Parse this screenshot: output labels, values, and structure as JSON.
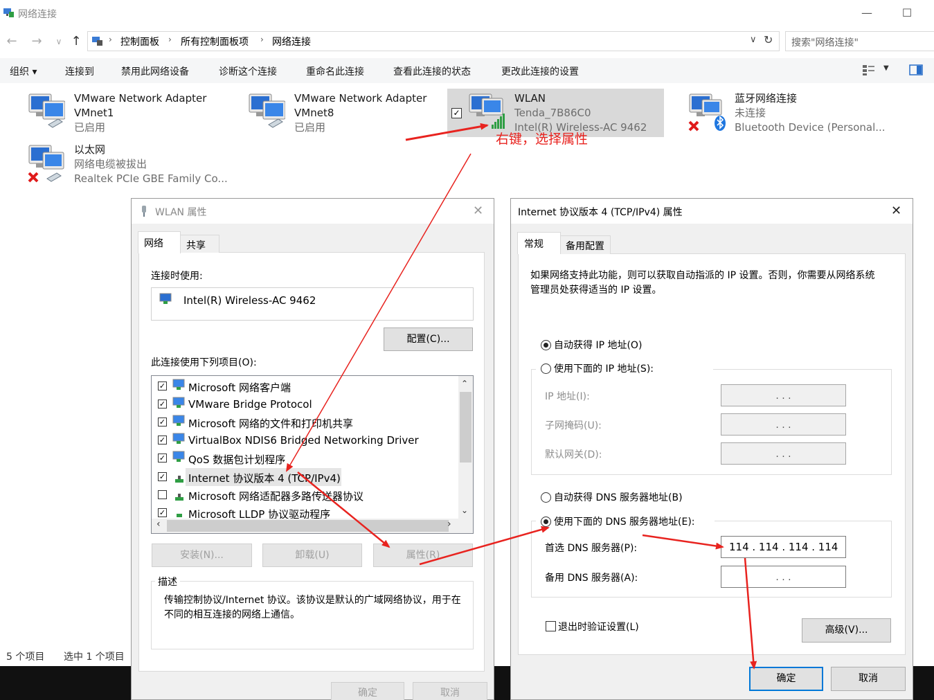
{
  "window": {
    "title": "网络连接",
    "breadcrumb": [
      "控制面板",
      "所有控制面板项",
      "网络连接"
    ],
    "search_placeholder": "搜索\"网络连接\""
  },
  "toolbar": {
    "organize": "组织 ▾",
    "items": [
      "连接到",
      "禁用此网络设备",
      "诊断这个连接",
      "重命名此连接",
      "查看此连接的状态",
      "更改此连接的设置"
    ]
  },
  "connections": [
    {
      "name": "VMware Network Adapter VMnet1",
      "line1": "VMware Network Adapter",
      "line2": "VMnet1",
      "status": "已启用"
    },
    {
      "name": "VMware Network Adapter VMnet8",
      "line1": "VMware Network Adapter",
      "line2": "VMnet8",
      "status": "已启用"
    },
    {
      "name": "WLAN",
      "line1": "WLAN",
      "line2": "Tenda_7B86C0",
      "status": "Intel(R) Wireless-AC 9462"
    },
    {
      "name": "蓝牙网络连接",
      "line1": "蓝牙网络连接",
      "line2": "未连接",
      "status": "Bluetooth Device (Personal..."
    },
    {
      "name": "以太网",
      "line1": "以太网",
      "line2": "网络电缆被拔出",
      "status": "Realtek PCIe GBE Family Co..."
    }
  ],
  "annotation": "右键，选择属性",
  "statusbar": {
    "count": "5 个项目",
    "selected": "选中 1 个项目"
  },
  "wlan_dialog": {
    "title": "WLAN 属性",
    "tabs": [
      "网络",
      "共享"
    ],
    "connect_using_label": "连接时使用:",
    "adapter": "Intel(R) Wireless-AC 9462",
    "configure_button": "配置(C)...",
    "items_label": "此连接使用下列项目(O):",
    "items": [
      {
        "label": "Microsoft 网络客户端",
        "checked": true
      },
      {
        "label": "VMware Bridge Protocol",
        "checked": true
      },
      {
        "label": "Microsoft 网络的文件和打印机共享",
        "checked": true
      },
      {
        "label": "VirtualBox NDIS6 Bridged Networking Driver",
        "checked": true
      },
      {
        "label": "QoS 数据包计划程序",
        "checked": true
      },
      {
        "label": "Internet 协议版本 4 (TCP/IPv4)",
        "checked": true
      },
      {
        "label": "Microsoft 网络适配器多路传送器协议",
        "checked": false
      },
      {
        "label": "Microsoft LLDP 协议驱动程序",
        "checked": true
      }
    ],
    "install_button": "安装(N)...",
    "uninstall_button": "卸载(U)",
    "properties_button": "属性(R)",
    "description_label": "描述",
    "description": "传输控制协议/Internet 协议。该协议是默认的广域网络协议，用于在不同的相互连接的网络上通信。",
    "ok_button": "确定",
    "cancel_button": "取消"
  },
  "ipv4_dialog": {
    "title": "Internet 协议版本 4 (TCP/IPv4) 属性",
    "tabs": [
      "常规",
      "备用配置"
    ],
    "intro": "如果网络支持此功能，则可以获取自动指派的 IP 设置。否则，你需要从网络系统管理员处获得适当的 IP 设置。",
    "auto_ip": "自动获得 IP 地址(O)",
    "manual_ip": "使用下面的 IP 地址(S):",
    "ip_label": "IP 地址(I):",
    "mask_label": "子网掩码(U):",
    "gateway_label": "默认网关(D):",
    "auto_dns": "自动获得 DNS 服务器地址(B)",
    "manual_dns": "使用下面的 DNS 服务器地址(E):",
    "preferred_dns_label": "首选 DNS 服务器(P):",
    "preferred_dns_value": "114 . 114 . 114 . 114",
    "alternate_dns_label": "备用 DNS 服务器(A):",
    "empty_ip": ".      .      .",
    "validate_label": "退出时验证设置(L)",
    "advanced_button": "高级(V)...",
    "ok_button": "确定",
    "cancel_button": "取消"
  },
  "colors": {
    "annotation_red": "#e8231f",
    "selection": "#d9d9d9",
    "focus_blue": "#0078d7"
  }
}
